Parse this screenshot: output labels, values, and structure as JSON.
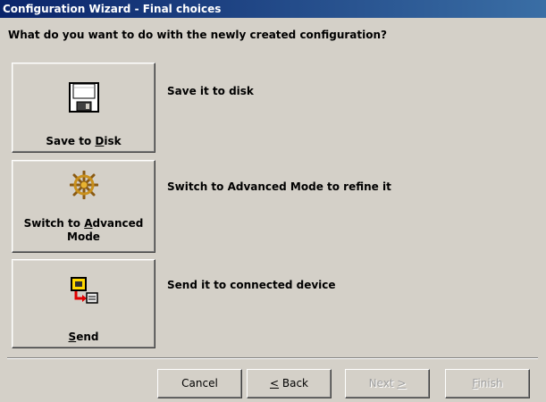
{
  "window": {
    "title": "Configuration Wizard - Final choices"
  },
  "question": "What do you want to do with the newly created configuration?",
  "options": [
    {
      "label_pre": "Save to ",
      "label_mnemonic": "D",
      "label_post": "isk",
      "label_line2": "",
      "description": "Save it to disk",
      "icon": "floppy-disk-icon"
    },
    {
      "label_pre": "Switch to ",
      "label_mnemonic": "A",
      "label_post": "dvanced",
      "label_line2": "Mode",
      "description": "Switch to Advanced Mode to refine it",
      "icon": "ship-wheel-icon"
    },
    {
      "label_pre": "",
      "label_mnemonic": "S",
      "label_post": "end",
      "label_line2": "",
      "description": "Send it to connected device",
      "icon": "send-to-device-icon"
    }
  ],
  "nav": {
    "cancel": "Cancel",
    "back": "< Back",
    "next": "Next >",
    "finish": "Finish"
  },
  "nav_chars": {
    "back_mn": "<",
    "back_rest": " Back",
    "next_pre": "Next ",
    "next_mn": ">",
    "finish_mn": "F",
    "finish_rest": "inish"
  },
  "colors": {
    "titlebar_start": "#0a246a",
    "titlebar_end": "#3a6ea5",
    "face": "#d4d0c8"
  }
}
